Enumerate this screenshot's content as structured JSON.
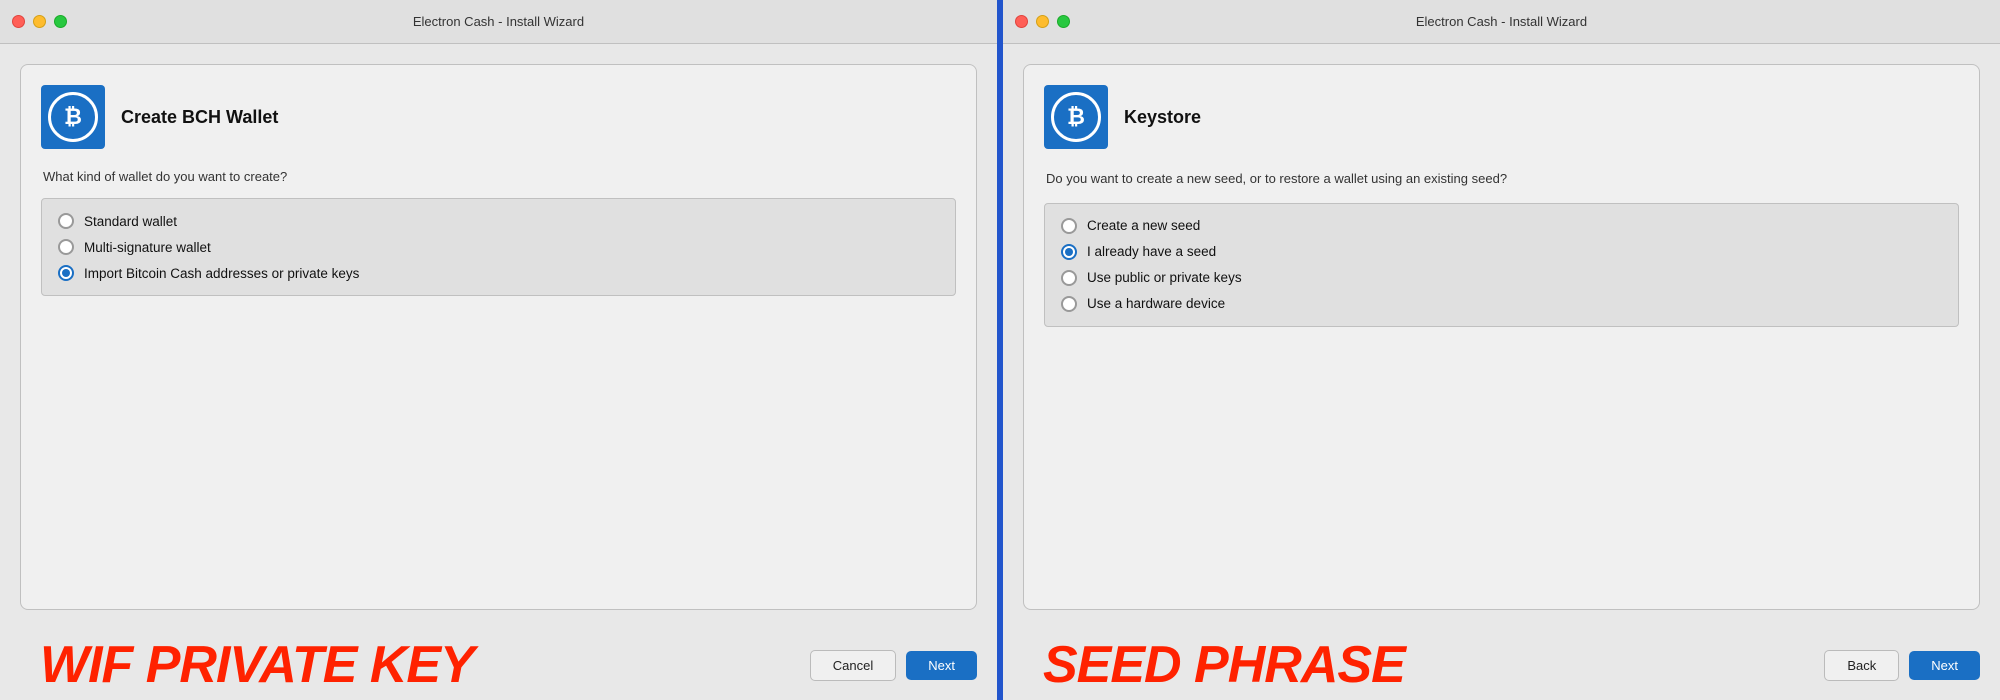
{
  "left_panel": {
    "title_bar": "Electron Cash  -  Install Wizard",
    "logo_symbol": "₿",
    "dialog_title": "Create BCH Wallet",
    "question": "What kind of wallet do you want to create?",
    "options": [
      {
        "id": "standard",
        "label": "Standard wallet",
        "selected": false
      },
      {
        "id": "multisig",
        "label": "Multi-signature wallet",
        "selected": false
      },
      {
        "id": "import",
        "label": "Import Bitcoin Cash addresses or private keys",
        "selected": true
      }
    ],
    "cancel_label": "Cancel",
    "next_label": "Next",
    "bottom_label": "WIF PRIVATE KEY"
  },
  "right_panel": {
    "title_bar": "Electron Cash  -  Install Wizard",
    "logo_symbol": "₿",
    "dialog_title": "Keystore",
    "question": "Do you want to create a new seed, or to restore a wallet using an existing seed?",
    "options": [
      {
        "id": "new-seed",
        "label": "Create a new seed",
        "selected": false
      },
      {
        "id": "have-seed",
        "label": "I already have a seed",
        "selected": true
      },
      {
        "id": "public-private",
        "label": "Use public or private keys",
        "selected": false
      },
      {
        "id": "hardware",
        "label": "Use a hardware device",
        "selected": false
      }
    ],
    "back_label": "Back",
    "next_label": "Next",
    "bottom_label": "SEED PHRASE"
  }
}
